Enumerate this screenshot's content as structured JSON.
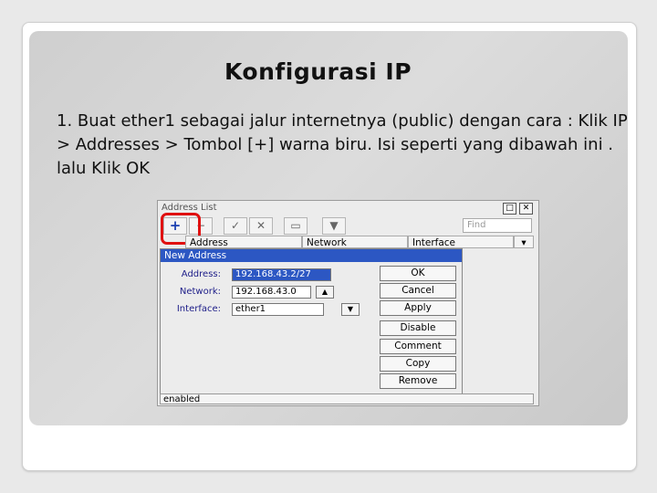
{
  "slide": {
    "title": "Konfigurasi IP",
    "body": "1. Buat ether1 sebagai jalur internetnya (public) dengan cara : Klik IP > Addresses > Tombol [+] warna biru. Isi seperti yang dibawah ini . lalu Klik OK"
  },
  "window": {
    "title": "Address List",
    "find_placeholder": "Find",
    "columns": [
      "Address",
      "Network",
      "Interface"
    ],
    "toolbar_icons": [
      "plus-icon",
      "minus-icon",
      "check-icon",
      "cross-icon",
      "comment-icon",
      "filter-icon"
    ],
    "status": "enabled"
  },
  "dialog": {
    "title": "New Address",
    "address_label": "Address:",
    "address_value": "192.168.43.2/27",
    "network_label": "Network:",
    "network_value": "192.168.43.0",
    "interface_label": "Interface:",
    "interface_value": "ether1",
    "buttons": [
      "OK",
      "Cancel",
      "Apply",
      "Disable",
      "Comment",
      "Copy",
      "Remove"
    ]
  },
  "colors": {
    "highlight": "#e01010",
    "title_bar": "#2c57c3",
    "plus_icon": "#1a3fb0"
  }
}
